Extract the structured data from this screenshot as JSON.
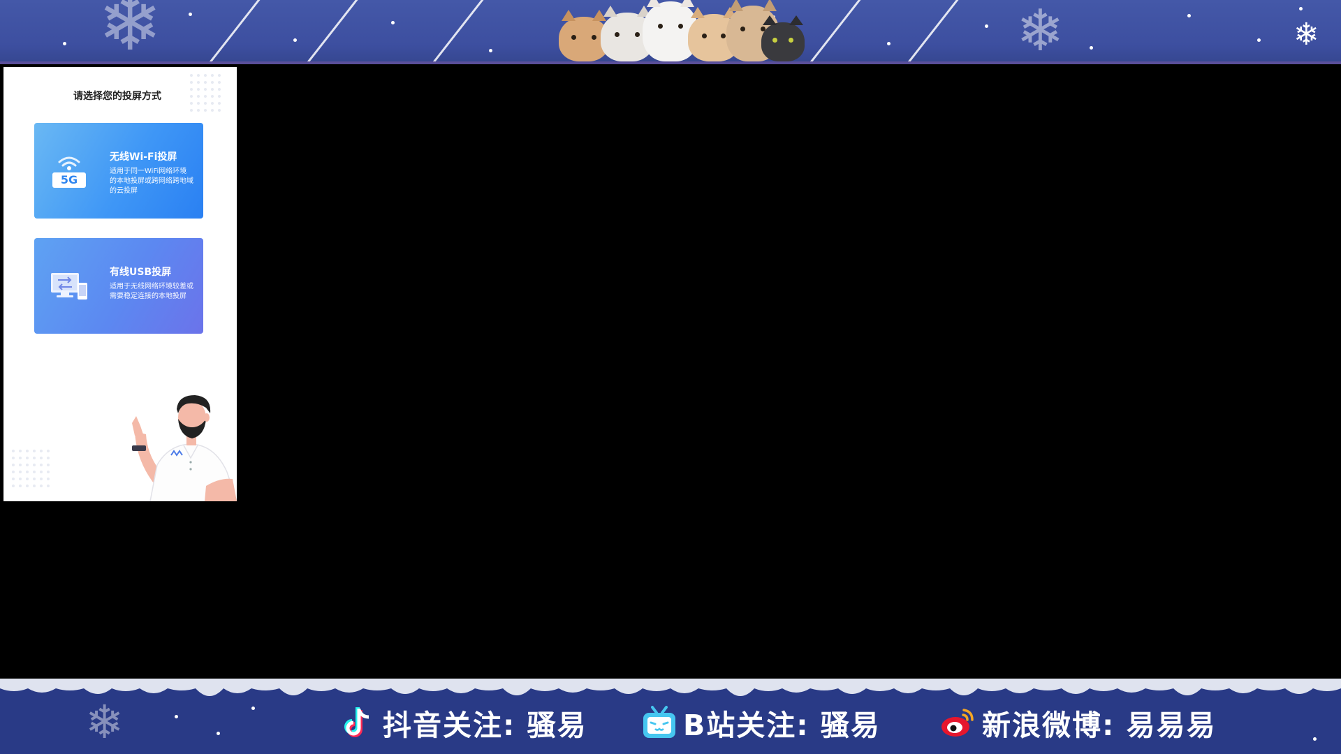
{
  "top_banner": {
    "icons": [
      "snowflake-icon",
      "snowflake-icon",
      "snowflake-icon"
    ]
  },
  "cast_panel": {
    "title": "请选择您的投屏方式",
    "wifi_card": {
      "title": "无线Wi-Fi投屏",
      "description": "适用于同一WiFi网络环境的本地投屏或跨网络跨地域的云投屏",
      "badge": "5G",
      "icon": "wifi-5g-icon"
    },
    "usb_card": {
      "title": "有线USB投屏",
      "description": "适用于无线网络环境较差或需要稳定连接的本地投屏",
      "icon": "usb-devices-icon"
    }
  },
  "social_bar": {
    "douyin": {
      "label": "抖音关注:  骚易",
      "icon": "douyin-icon",
      "color": "#ff2a55"
    },
    "bilibili": {
      "label": "B站关注:  骚易",
      "icon": "bilibili-tv-icon",
      "color": "#46c6f0"
    },
    "weibo": {
      "label": "新浪微博:  易易易",
      "icon": "weibo-icon",
      "color": "#e6162d"
    }
  }
}
